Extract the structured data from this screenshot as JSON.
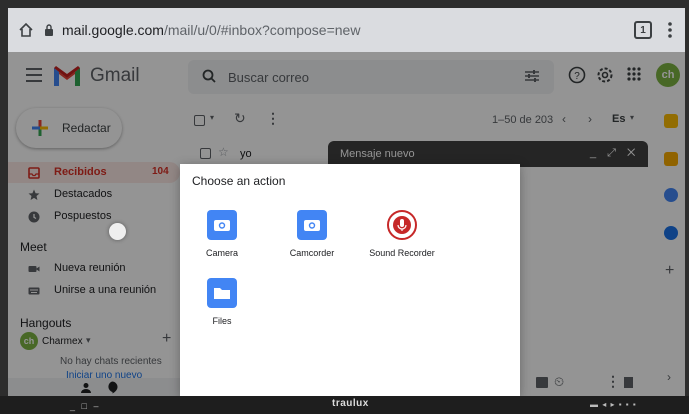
{
  "browser": {
    "url_host": "mail.google.com",
    "url_path": "/mail/u/0/#inbox?compose=new",
    "tab_count": "1"
  },
  "gmail": {
    "brand": "Gmail",
    "search_placeholder": "Buscar correo",
    "avatar_initials": "ch",
    "compose_label": "Redactar",
    "nav": [
      {
        "label": "Recibidos",
        "count": "104"
      },
      {
        "label": "Destacados"
      },
      {
        "label": "Pospuestos"
      }
    ],
    "meet": {
      "title": "Meet",
      "items": [
        "Nueva reunión",
        "Unirse a una reunión"
      ]
    },
    "hangouts": {
      "title": "Hangouts",
      "user": "Charmex",
      "empty_text": "No hay chats recientes",
      "start_link": "Iniciar uno nuevo"
    },
    "toolbar": {
      "pagination": "1–50 de 203",
      "lang": "Es"
    },
    "row_sender": "yo",
    "new_message_title": "Mensaje nuevo",
    "new_message_controls": "_ ⤢ ✕"
  },
  "dialog": {
    "title": "Choose an action",
    "apps": [
      {
        "label": "Camera",
        "icon": "camera-icon",
        "color": "#4285f4"
      },
      {
        "label": "Camcorder",
        "icon": "camcorder-icon",
        "color": "#4285f4"
      },
      {
        "label": "Sound Recorder",
        "icon": "microphone-icon",
        "color": "#c62828"
      },
      {
        "label": "Files",
        "icon": "folder-icon",
        "color": "#4285f4"
      }
    ]
  },
  "taskbar": {
    "brand": "traulux"
  },
  "colors": {
    "gmail_red": "#d93025",
    "accent_blue": "#4285f4",
    "avatar_green": "#7cb342"
  }
}
